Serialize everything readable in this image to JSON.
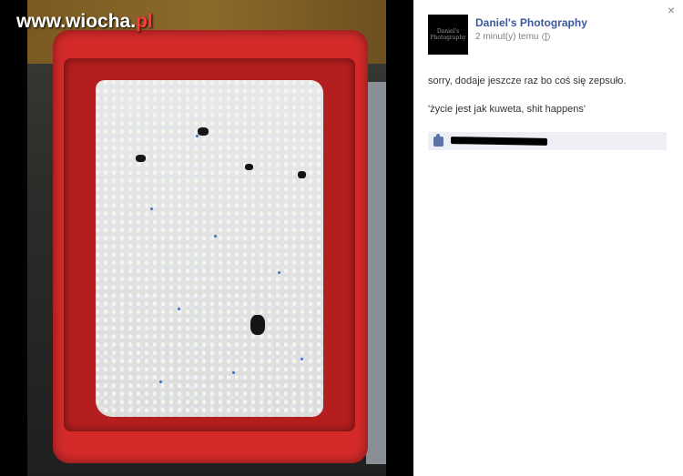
{
  "watermark": {
    "site_name": "www.wiocha",
    "dot": ".",
    "tld": "pl"
  },
  "photo": {
    "description_icon": "litter-box-photo",
    "colors": {
      "tray": "#d42a2a",
      "litter": "#e6e6e4",
      "blue_specks": "#3b6fd1",
      "clumps": "#151515"
    }
  },
  "sidebar": {
    "close_label": "×",
    "avatar_text": "Daniel's Photography",
    "page_name": "Daniel's Photography",
    "timestamp": "2 minut(y) temu",
    "privacy_icon": "globe-icon",
    "post_lines": [
      "sorry, dodaje jeszcze raz bo coś się zepsuło.",
      "'życie jest jak kuweta, shit happens'"
    ],
    "likes": {
      "icon": "like-icon"
    }
  },
  "colors": {
    "link": "#3b5998",
    "likes_bar_bg": "#edeff4"
  }
}
